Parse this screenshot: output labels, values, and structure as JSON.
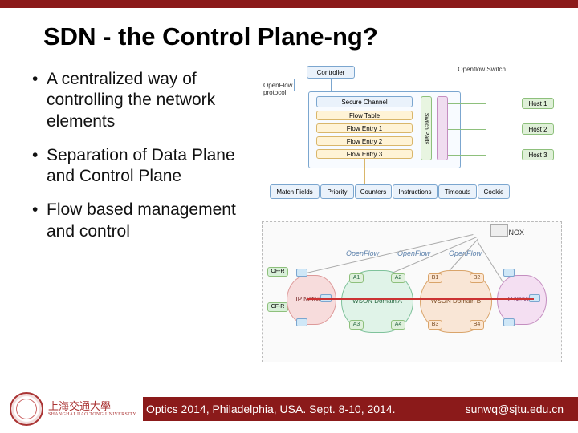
{
  "colors": {
    "accent": "#8b1a1a"
  },
  "title": "SDN - the Control Plane-ng?",
  "bullets": [
    "A centralized way of controlling the network elements",
    "Separation of Data Plane and Control Plane",
    "Flow based management and control"
  ],
  "diagram_top": {
    "controller": "Controller",
    "openflow_protocol": "OpenFlow protocol",
    "switch_label": "Openflow Switch",
    "secure_channel": "Secure Channel",
    "flow_table": "Flow Table",
    "flow_entry1": "Flow Entry 1",
    "flow_entry2": "Flow Entry 2",
    "flow_entry3": "Flow Entry 3",
    "switch_parts": "Switch Parts",
    "host1": "Host 1",
    "host2": "Host 2",
    "host3": "Host 3",
    "row_labels": [
      "Match Fields",
      "Priority",
      "Counters",
      "Instructions",
      "Timeouts",
      "Cookie"
    ]
  },
  "diagram_bottom": {
    "nox": "NOX",
    "openflow": "OpenFlow",
    "ofr": "OF-R",
    "cfr": "CF-R",
    "ip_network_left": "IP Network",
    "wson_a": "WSON Domain A",
    "wson_b": "WSON Domain B",
    "ip_network_right": "IP Network",
    "A": [
      "A1",
      "A2",
      "A3",
      "A4"
    ],
    "B": [
      "B1",
      "B2",
      "B3",
      "B4"
    ]
  },
  "footer": {
    "university": "上海交通大學",
    "university_en": "SHANGHAI JIAO TONG UNIVERSITY",
    "conference": "Optics 2014, Philadelphia, USA. Sept. 8-10, 2014.",
    "email": "sunwq@sjtu.edu.cn"
  }
}
